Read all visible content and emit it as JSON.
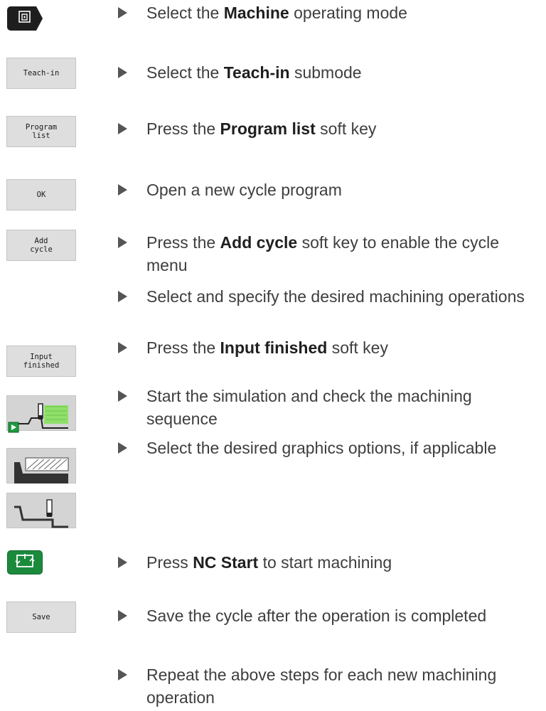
{
  "keys": {
    "teach_in": "Teach-in",
    "program_list": "Program\nlist",
    "ok": "OK",
    "add_cycle": "Add\ncycle",
    "input_finished": "Input\nfinished",
    "save": "Save"
  },
  "icons": {
    "machine_mode": "machine-mode-key-icon",
    "simulation": "simulation-softkey-icon",
    "graphics_contour": "graphics-contour-softkey-icon",
    "graphics_tool": "graphics-tool-softkey-icon",
    "nc_start": "nc-start-key-icon"
  },
  "colors": {
    "nc_start": "#1c8a3c",
    "sim_play": "#1f9a3f",
    "sim_highlight": "#8fe06a"
  },
  "steps": [
    {
      "pre": "Select the ",
      "bold": "Machine",
      "post": " operating mode"
    },
    {
      "pre": "Select the ",
      "bold": "Teach-in",
      "post": " submode"
    },
    {
      "pre": "Press the ",
      "bold": "Program list",
      "post": " soft key"
    },
    {
      "pre": "Open a new cycle program",
      "bold": "",
      "post": ""
    },
    {
      "pre": "Press the ",
      "bold": "Add cycle",
      "post": " soft key to enable the cycle menu"
    },
    {
      "pre": "Select and specify the desired machining operations",
      "bold": "",
      "post": ""
    },
    {
      "pre": "Press the ",
      "bold": "Input finished",
      "post": " soft key"
    },
    {
      "pre": "Start the simulation and check the machining sequence",
      "bold": "",
      "post": ""
    },
    {
      "pre": "Select the desired graphics options, if applicable",
      "bold": "",
      "post": ""
    },
    {
      "pre": "Press ",
      "bold": "NC Start",
      "post": " to start machining"
    },
    {
      "pre": "Save the cycle after the operation is completed",
      "bold": "",
      "post": ""
    },
    {
      "pre": "Repeat the above steps for each new machining operation",
      "bold": "",
      "post": ""
    }
  ]
}
